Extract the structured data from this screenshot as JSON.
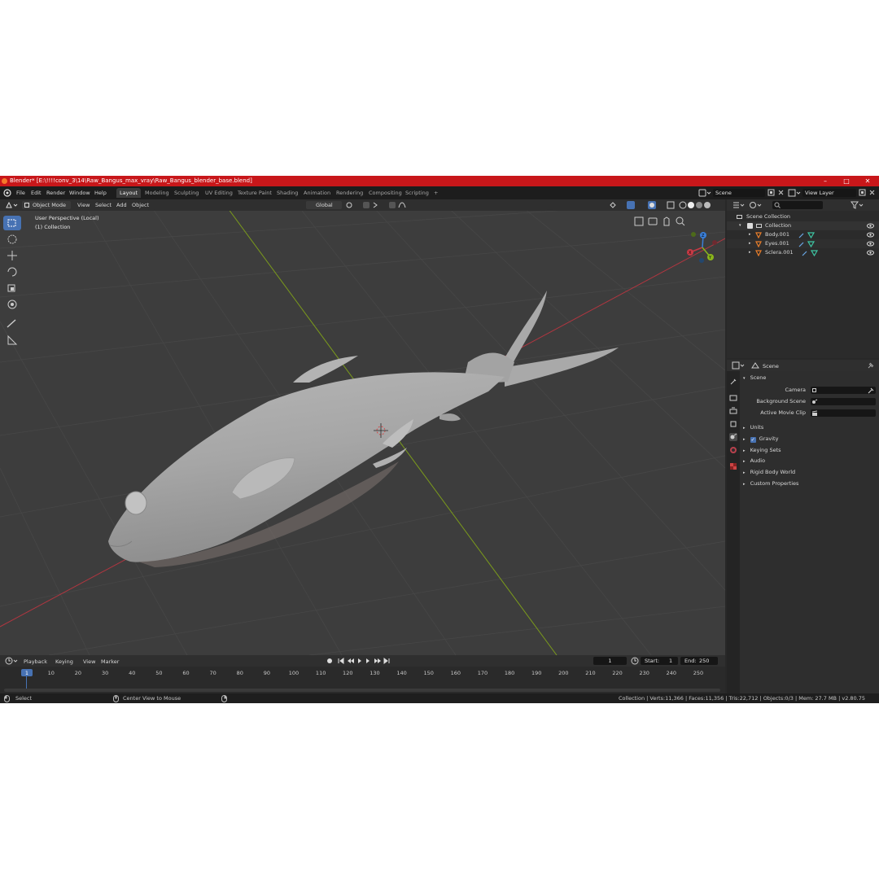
{
  "window": {
    "title": "Blender* [E:\\!!!!conv_3\\14\\Raw_Bangus_max_vray\\Raw_Bangus_blender_base.blend]",
    "controls": [
      "–",
      "□",
      "✕"
    ]
  },
  "menu": [
    "File",
    "Edit",
    "Render",
    "Window",
    "Help"
  ],
  "workspaces": [
    "Layout",
    "Modeling",
    "Sculpting",
    "UV Editing",
    "Texture Paint",
    "Shading",
    "Animation",
    "Rendering",
    "Compositing",
    "Scripting",
    "+"
  ],
  "active_workspace": "Layout",
  "scene_field": "Scene",
  "view_layer_field": "View Layer",
  "viewport": {
    "mode": "Object Mode",
    "menus": [
      "View",
      "Select",
      "Add",
      "Object"
    ],
    "transform_orientation": "Global",
    "perspective_label": "User Perspective (Local)",
    "collection_label": "(1) Collection",
    "gizmo_axes": [
      "X",
      "Y",
      "Z"
    ]
  },
  "outliner": {
    "root": "Scene Collection",
    "collection": "Collection",
    "objects": [
      "Body.001",
      "Eyes.001",
      "Sclera.001"
    ]
  },
  "properties": {
    "context": "Scene",
    "panel_title": "Scene",
    "fields": [
      {
        "label": "Camera",
        "value": ""
      },
      {
        "label": "Background Scene",
        "value": ""
      },
      {
        "label": "Active Movie Clip",
        "value": ""
      }
    ],
    "sections": [
      "Units",
      "Gravity",
      "Keying Sets",
      "Audio",
      "Rigid Body World",
      "Custom Properties"
    ],
    "gravity_checked": true
  },
  "timeline": {
    "menus": [
      "Playback",
      "Keying",
      "View",
      "Marker"
    ],
    "current_frame": "1",
    "start_label": "Start:",
    "start": "1",
    "end_label": "End:",
    "end": "250",
    "ticks": [
      "1",
      "10",
      "20",
      "30",
      "40",
      "50",
      "60",
      "70",
      "80",
      "90",
      "100",
      "110",
      "120",
      "130",
      "140",
      "150",
      "160",
      "170",
      "180",
      "190",
      "200",
      "210",
      "220",
      "230",
      "240",
      "250"
    ]
  },
  "status": {
    "select": "Select",
    "center": "Center View to Mouse",
    "stats": "Collection | Verts:11,366 | Faces:11,356 | Tris:22,712 | Objects:0/3 | Mem: 27.7 MB | v2.80.75"
  },
  "colors": {
    "titlebar": "#c8171a",
    "accent": "#4772b3",
    "viewport_bg": "#3d3d3d",
    "x_axis": "#c93a45",
    "y_axis": "#8ab51c",
    "z_axis": "#3a7fd8",
    "mesh_icon": "#e87d2a",
    "data_icon": "#3ec6a4"
  }
}
